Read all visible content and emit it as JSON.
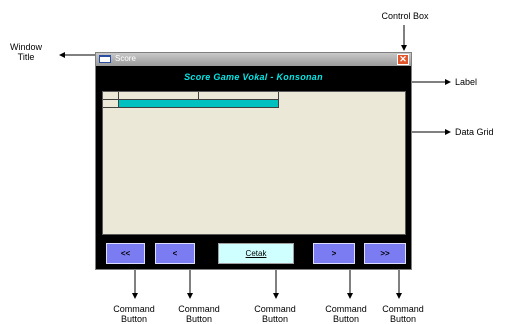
{
  "annotations": {
    "window_title": "Window Title",
    "control_box": "Control Box",
    "label": "Label",
    "data_grid": "Data Grid",
    "command_button": "Command Button"
  },
  "window": {
    "title": "Score",
    "close_glyph": "✕",
    "heading": "Score Game Vokal - Konsonan"
  },
  "buttons": {
    "first": "<<",
    "prev": "<",
    "print": "Cetak",
    "next": ">",
    "last": ">>"
  },
  "colors": {
    "accent_button": "#7b7bf2",
    "print_button": "#cfffff",
    "heading_text": "#00e6e6",
    "grid_highlight": "#00c0c0"
  },
  "icons": [
    "window-icon",
    "close-icon"
  ]
}
